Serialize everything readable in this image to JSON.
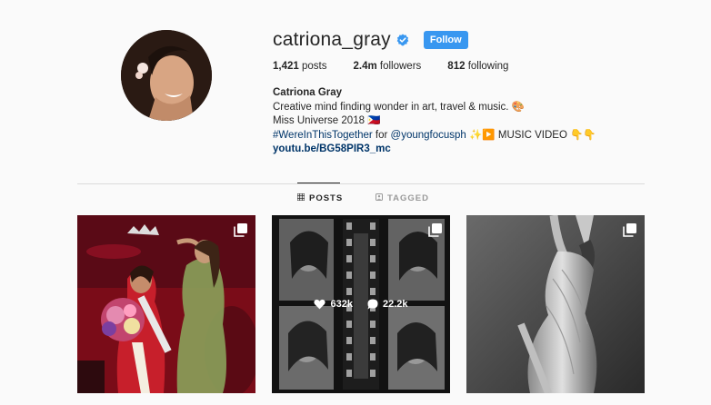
{
  "profile": {
    "username": "catriona_gray",
    "follow_label": "Follow",
    "stats": {
      "posts_count": "1,421",
      "posts_label": "posts",
      "followers_count": "2.4m",
      "followers_label": "followers",
      "following_count": "812",
      "following_label": "following"
    },
    "bio": {
      "name": "Catriona Gray",
      "line1": "Creative mind finding wonder in art, travel & music. 🎨",
      "line2": "Miss Universe 2018 🇵🇭",
      "hashtag": "#WereInThisTogether",
      "line3_mid": " for ",
      "mention": "@youngfocusph",
      "line3_end": " ✨▶️ MUSIC VIDEO 👇👇",
      "link": "youtu.be/BG58PIR3_mc"
    }
  },
  "tabs": [
    {
      "label": "POSTS",
      "active": true
    },
    {
      "label": "TAGGED",
      "active": false
    }
  ],
  "posts": [
    {
      "type": "carousel"
    },
    {
      "type": "carousel",
      "likes": "632k",
      "comments": "22.2k"
    },
    {
      "type": "carousel"
    }
  ],
  "colors": {
    "accent": "#3897f0",
    "link": "#003569",
    "text": "#262626",
    "muted": "#999999",
    "background": "#fafafa"
  }
}
